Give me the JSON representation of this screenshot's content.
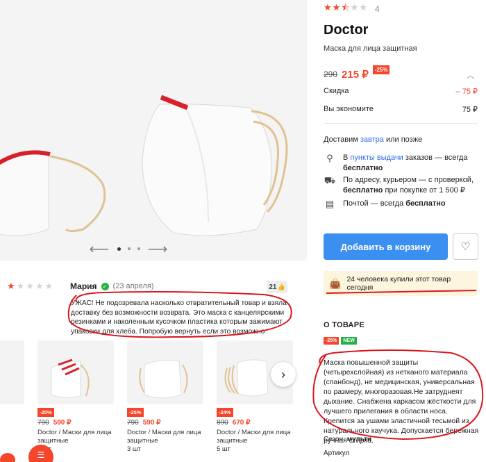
{
  "product": {
    "rating": 2.5,
    "review_count": "4",
    "brand": "Doctor",
    "name": "Маска для лица защитная",
    "old_price": "290",
    "price": "215 ₽",
    "discount": "-25%",
    "discount_label": "Скидка",
    "discount_value": "– 75 ₽",
    "savings_label": "Вы экономите",
    "savings_value": "75 ₽"
  },
  "delivery": {
    "prefix": "Доставим",
    "when": "завтра",
    "suffix": "или позже",
    "pickup_pre": "В",
    "pickup_link": "пункты выдачи",
    "pickup_post": "заказов — всегда",
    "pickup_free": "бесплатно",
    "courier_line1": "По адресу, курьером — с проверкой,",
    "courier_free": "бесплатно",
    "courier_post": "при покупке от 1 500 ₽",
    "mail_pre": "Почтой — всегда",
    "mail_free": "бесплатно"
  },
  "buttons": {
    "add_to_cart": "Добавить в корзину"
  },
  "bought_today": "24 человека купили этот товар сегодня",
  "about": {
    "title": "О ТОВАРЕ",
    "badge_discount": "-25%",
    "badge_new": "NEW",
    "description": "Маска повышенной защиты (четырехслойная) из нетканого материала (спанбонд), не медицинская, универсальная по размеру, многоразовая.Не затруднеят дыхание. Снабжена каркасом жёсткости для лучшего прилегания в области носа. Крепится за ушами эластичной тесьмой из натурального каучука. Допускается бережная ручная стирка.",
    "season_label": "Сезон:",
    "season_value": "мульти",
    "article_label": "Артикул"
  },
  "review": {
    "rating": 1,
    "author": "Мария",
    "date": "(23 апреля)",
    "likes": "21",
    "text": "УЖАС! Не подозревала насколько отвратительный товар и взяла доставку без возможности возврата. Это маска с канцелярскими резинками и наколенным кусочком пластика которым зажимают упаковки для хлеба. Попробую вернуть если это возможно"
  },
  "carousel": [
    {
      "badge": "-25%",
      "old": "790",
      "new": "590 ₽",
      "name": "Doctor / Маски для лица защитные",
      "qty": "3 шт"
    },
    {
      "badge": "-25%",
      "old": "790",
      "new": "590 ₽",
      "name": "Doctor / Маски для лица защитные",
      "qty": "3 шт"
    },
    {
      "badge": "-24%",
      "old": "890",
      "new": "670 ₽",
      "name": "Doctor / Маски для лица защитные",
      "qty": "5 шт"
    }
  ],
  "colors": {
    "accent": "#f5452b",
    "button": "#3b8ff0",
    "annotation": "#d8171f"
  }
}
